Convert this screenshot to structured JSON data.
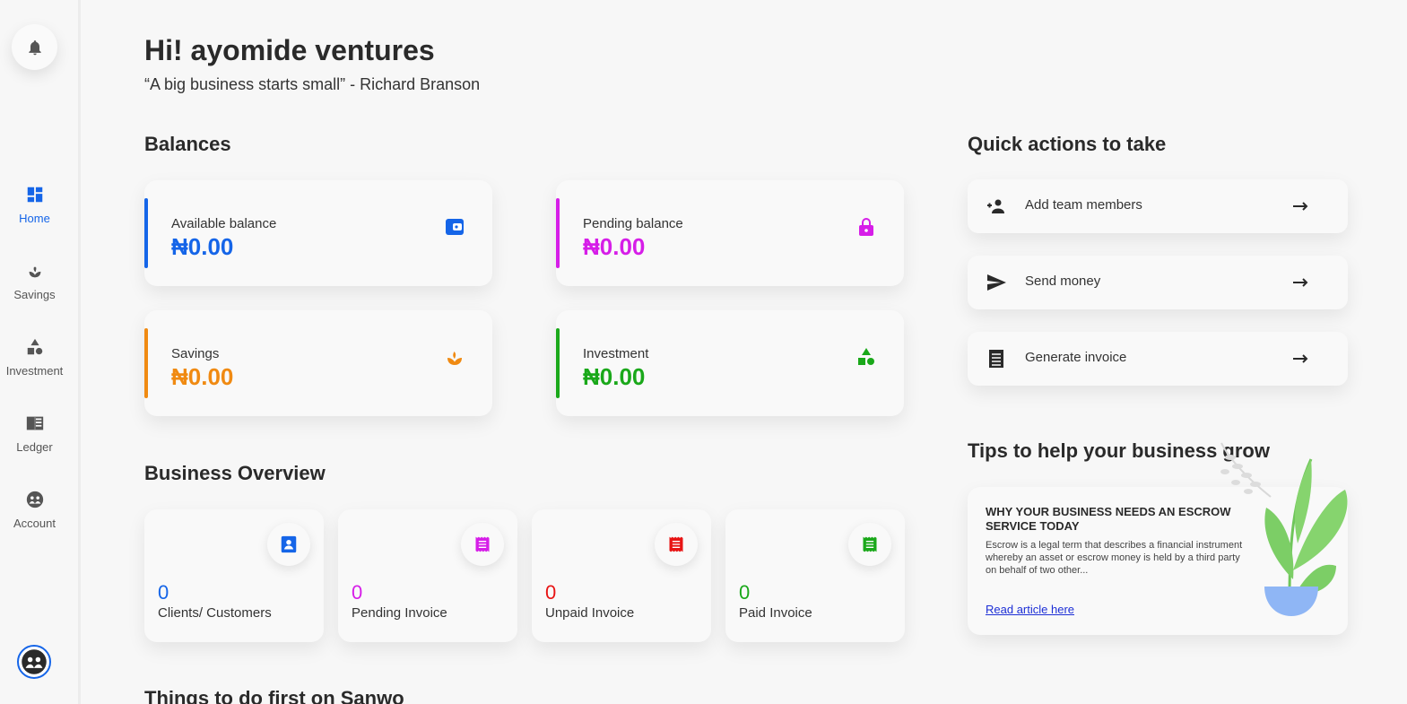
{
  "sidebar": {
    "items": [
      {
        "label": "Home",
        "icon": "dashboard-icon",
        "active": true
      },
      {
        "label": "Savings",
        "icon": "sprout-icon"
      },
      {
        "label": "Investment",
        "icon": "shapes-icon"
      },
      {
        "label": "Ledger",
        "icon": "book-icon"
      },
      {
        "label": "Account",
        "icon": "account-icon"
      }
    ]
  },
  "header": {
    "greeting": "Hi! ayomide ventures",
    "quote": "“A big business starts small” - Richard Branson"
  },
  "balances": {
    "title": "Balances",
    "cards": [
      {
        "label": "Available balance",
        "amount": "₦0.00",
        "color": "#1565e8",
        "icon": "wallet-icon"
      },
      {
        "label": "Pending balance",
        "amount": "₦0.00",
        "color": "#d61ee8",
        "icon": "lock-icon"
      },
      {
        "label": "Savings",
        "amount": "₦0.00",
        "color": "#f08a12",
        "icon": "sprout-icon"
      },
      {
        "label": "Investment",
        "amount": "₦0.00",
        "color": "#1aa81a",
        "icon": "shapes-icon"
      }
    ]
  },
  "quick_actions": {
    "title": "Quick actions to take",
    "items": [
      {
        "label": "Add team members",
        "icon": "add-people-icon"
      },
      {
        "label": "Send money",
        "icon": "send-icon"
      },
      {
        "label": "Generate invoice",
        "icon": "invoice-icon"
      }
    ]
  },
  "overview": {
    "title": "Business Overview",
    "cards": [
      {
        "value": "0",
        "label": "Clients/ Customers",
        "color": "#1565e8",
        "icon": "contact-icon"
      },
      {
        "value": "0",
        "label": "Pending Invoice",
        "color": "#d61ee8",
        "icon": "receipt-icon"
      },
      {
        "value": "0",
        "label": "Unpaid Invoice",
        "color": "#e81414",
        "icon": "receipt-icon"
      },
      {
        "value": "0",
        "label": "Paid Invoice",
        "color": "#1aa81a",
        "icon": "receipt-icon"
      }
    ]
  },
  "tips": {
    "title": "Tips to help your business grow",
    "article_title": "WHY YOUR BUSINESS NEEDS AN ESCROW SERVICE TODAY",
    "article_body": "Escrow is a legal term that describes a financial instrument whereby an asset or escrow money is held by a third party on behalf of two other...",
    "link": "Read article here"
  },
  "things_title": "Things to do first on Sanwo"
}
